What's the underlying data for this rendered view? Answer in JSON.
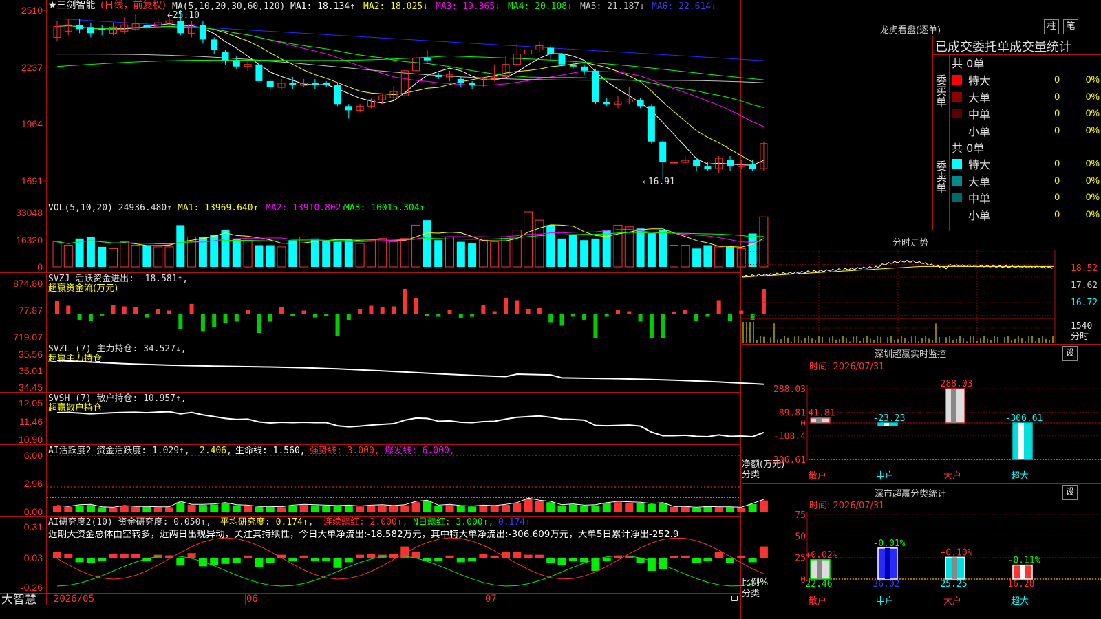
{
  "colors": {
    "up": "#ff3232",
    "down": "#00ffff",
    "grid": "#b01010",
    "ma1": "#ffffff",
    "ma2": "#ffff00",
    "ma3": "#ff00ff",
    "ma4": "#00ff00",
    "ma5": "#c0c0c0",
    "ma6": "#2828ff"
  },
  "header": {
    "stock_name": "★三剑智能",
    "period": "(日线，前复权)",
    "ma_params": "MA(5,10,20,30,60,120)",
    "ma1": "MA1: 18.134↑",
    "ma2": "MA2: 18.025↓",
    "ma3": "MA3: 19.365↓",
    "ma4": "MA4: 20.108↓",
    "ma5": "MA5: 21.187↓",
    "ma6": "MA6: 22.614↓",
    "high_mark": "←25.10",
    "low_mark": "←16.91"
  },
  "price_axis": [
    "2510",
    "2237",
    "1964",
    "1691"
  ],
  "vol_panel": {
    "title": "VOL(5,10,20) 24936.480↑",
    "ma1": "MA1: 13969.640↑",
    "ma2": "MA2: 13910.802↑",
    "ma3": "MA3: 16015.304↑",
    "axis": [
      "33048",
      "16320",
      "0"
    ]
  },
  "svzj_panel": {
    "title": "SVZJ  活跃资金进出: -18.581↑,",
    "subtitle": "超赢资金流(万元)",
    "axis": [
      "874.80",
      "77.87",
      "-719.07"
    ]
  },
  "svzl_panel": {
    "title": "SVZL (7) 主力持仓: 34.527↓,",
    "subtitle": "超赢主力持仓",
    "axis": [
      "35.56",
      "35.01",
      "34.45"
    ]
  },
  "svsh_panel": {
    "title": "SVSH (7) 散户持仓: 10.957↑,",
    "subtitle": "超赢散户持仓",
    "axis": [
      "12.05",
      "11.46",
      "10.90"
    ]
  },
  "ai1_panel": {
    "title": "AI活跃度2 资金活跃度: 1.029↑,",
    "v2": "2.406,",
    "life": "生命线: 1.560,",
    "strong": "强势线: 3.000,",
    "burst": "爆发线: 6.000,",
    "axis": [
      "6.00",
      "2.96",
      "0.00"
    ]
  },
  "ai2_panel": {
    "title": "AI研究度2(10) 资金研究度: 0.050↑,",
    "avg": "平均研究度: 0.174↑,",
    "cont": "连续飘红: 2.000↑,",
    "nday": "N日飘红: 3.000↑,",
    "last": "0.174↑",
    "commentary": "近期大资金总体由空转多，近两日出现异动，关注其持续性，今日大单净流出:-18.582万元，其中特大单净流出:-306.609万元，大单5日累计净出-252.9",
    "axis": [
      "0.31",
      "0.03",
      "-0.26"
    ]
  },
  "date_axis": [
    "2026/05",
    "06",
    "07"
  ],
  "logo": "大智慧",
  "right": {
    "dragon_title": "龙虎看盘(逐单)",
    "btn1": "柱",
    "btn2": "笔",
    "table_head": "已成交委托单成交量统计",
    "buy_label": "委买单",
    "sell_label": "委卖单",
    "buy_total": "共 0单",
    "sell_total": "共 0单",
    "buy_rows": [
      {
        "name": "特大",
        "val": "0",
        "pct": "0%",
        "color": "#ff0000"
      },
      {
        "name": "大单",
        "val": "0",
        "pct": "0%",
        "color": "#8b0000"
      },
      {
        "name": "中单",
        "val": "0",
        "pct": "0%",
        "color": "#5a0000"
      },
      {
        "name": "小单",
        "val": "0",
        "pct": "0%",
        "color": ""
      }
    ],
    "sell_rows": [
      {
        "name": "特大",
        "val": "0",
        "pct": "0%",
        "color": "#00ffff"
      },
      {
        "name": "大单",
        "val": "0",
        "pct": "0%",
        "color": "#008b8b"
      },
      {
        "name": "中单",
        "val": "0",
        "pct": "0%",
        "color": "#006b6b"
      },
      {
        "name": "小单",
        "val": "0",
        "pct": "0%",
        "color": ""
      }
    ],
    "intraday_title": "分时走势",
    "intraday_axis": [
      "18.52",
      "17.62",
      "16.72"
    ],
    "intraday_vol": "1540",
    "intraday_label": "分时",
    "sz_title": "深圳超赢实时监控",
    "sz_time": "时间: 2026/07/31",
    "sz_btn": "设",
    "sz_axis": [
      "288.03",
      "89.81",
      "0",
      "-108.4",
      "-306.61"
    ],
    "sz_bars": [
      {
        "cat": "散户",
        "value": 41.81,
        "label": "41.81"
      },
      {
        "cat": "中户",
        "value": -23.23,
        "label": "-23.23"
      },
      {
        "cat": "大户",
        "value": 288.03,
        "label": "288.03"
      },
      {
        "cat": "超大",
        "value": -306.61,
        "label": "-306.61"
      }
    ],
    "sz_ylabel": "净额(万元)",
    "sz_xlabel": "分类",
    "sc_title": "深市超赢分类统计",
    "sc_time": "时间: 2026/07/31",
    "sc_btn": "设",
    "sc_axis": [
      "75",
      "50",
      "25",
      "0"
    ],
    "sc_bars": [
      {
        "cat": "散户",
        "value": 22.46,
        "label": "22.46",
        "chg": "+0.02%"
      },
      {
        "cat": "中户",
        "value": 36.02,
        "label": "36.02",
        "chg": "-0.01%"
      },
      {
        "cat": "大户",
        "value": 25.25,
        "label": "25.25",
        "chg": "+0.10%"
      },
      {
        "cat": "超大",
        "value": 16.28,
        "label": "16.28",
        "chg": "-0.11%"
      }
    ],
    "sc_ylabel": "比例%",
    "sc_xlabel": "分类"
  },
  "chart_data": {
    "type": "candlestick",
    "candles": [
      [
        2380,
        2432,
        2460,
        2360
      ],
      [
        2410,
        2440,
        2470,
        2390
      ],
      [
        2440,
        2420,
        2470,
        2400
      ],
      [
        2430,
        2400,
        2450,
        2380
      ],
      [
        2420,
        2415,
        2440,
        2390
      ],
      [
        2400,
        2430,
        2450,
        2390
      ],
      [
        2410,
        2440,
        2480,
        2395
      ],
      [
        2420,
        2445,
        2490,
        2410
      ],
      [
        2440,
        2430,
        2460,
        2410
      ],
      [
        2430,
        2450,
        2480,
        2420
      ],
      [
        2450,
        2460,
        2500,
        2430
      ],
      [
        2460,
        2400,
        2510,
        2390
      ],
      [
        2400,
        2440,
        2460,
        2380
      ],
      [
        2440,
        2370,
        2460,
        2350
      ],
      [
        2370,
        2320,
        2380,
        2300
      ],
      [
        2310,
        2270,
        2320,
        2250
      ],
      [
        2270,
        2240,
        2290,
        2230
      ],
      [
        2240,
        2250,
        2280,
        2220
      ],
      [
        2250,
        2170,
        2260,
        2160
      ],
      [
        2170,
        2140,
        2180,
        2120
      ],
      [
        2140,
        2160,
        2180,
        2130
      ],
      [
        2160,
        2150,
        2190,
        2130
      ],
      [
        2150,
        2160,
        2180,
        2140
      ],
      [
        2160,
        2150,
        2180,
        2130
      ],
      [
        2160,
        2150,
        2170,
        2140
      ],
      [
        2150,
        2060,
        2160,
        2050
      ],
      [
        2050,
        2030,
        2060,
        1990
      ],
      [
        2030,
        2050,
        2060,
        2020
      ],
      [
        2050,
        2080,
        2090,
        2040
      ],
      [
        2080,
        2100,
        2110,
        2060
      ],
      [
        2090,
        2120,
        2140,
        2080
      ],
      [
        2100,
        2220,
        2230,
        2090
      ],
      [
        2220,
        2280,
        2300,
        2200
      ],
      [
        2280,
        2270,
        2320,
        2260
      ],
      [
        2200,
        2190,
        2210,
        2180
      ],
      [
        2190,
        2200,
        2220,
        2170
      ],
      [
        2180,
        2160,
        2190,
        2140
      ],
      [
        2160,
        2150,
        2170,
        2130
      ],
      [
        2150,
        2180,
        2190,
        2140
      ],
      [
        2180,
        2190,
        2250,
        2170
      ],
      [
        2190,
        2250,
        2290,
        2180
      ],
      [
        2250,
        2300,
        2350,
        2240
      ],
      [
        2300,
        2320,
        2340,
        2290
      ],
      [
        2320,
        2340,
        2360,
        2310
      ],
      [
        2330,
        2300,
        2340,
        2270
      ],
      [
        2300,
        2250,
        2310,
        2240
      ],
      [
        2250,
        2240,
        2260,
        2230
      ],
      [
        2240,
        2220,
        2250,
        2200
      ],
      [
        2220,
        2070,
        2230,
        2060
      ],
      [
        2070,
        2060,
        2090,
        2050
      ],
      [
        2060,
        2070,
        2100,
        2040
      ],
      [
        2070,
        2080,
        2140,
        2060
      ],
      [
        2080,
        2050,
        2090,
        2040
      ],
      [
        2050,
        1880,
        2060,
        1870
      ],
      [
        1880,
        1780,
        1890,
        1700
      ],
      [
        1780,
        1780,
        1800,
        1760
      ],
      [
        1780,
        1790,
        1810,
        1770
      ],
      [
        1790,
        1760,
        1800,
        1740
      ],
      [
        1760,
        1750,
        1780,
        1740
      ],
      [
        1750,
        1800,
        1810,
        1730
      ],
      [
        1790,
        1760,
        1810,
        1740
      ],
      [
        1760,
        1770,
        1790,
        1750
      ],
      [
        1770,
        1750,
        1790,
        1740
      ],
      [
        1750,
        1870,
        1880,
        1740
      ]
    ],
    "volume": [
      15,
      13,
      17,
      18,
      12,
      11,
      15,
      13,
      13,
      12,
      12,
      25,
      18,
      18,
      19,
      22,
      17,
      16,
      13,
      13,
      12,
      16,
      18,
      17,
      16,
      15,
      16,
      14,
      16,
      17,
      15,
      17,
      25,
      28,
      16,
      18,
      15,
      14,
      16,
      15,
      18,
      22,
      33,
      28,
      25,
      17,
      19,
      16,
      17,
      22,
      25,
      24,
      23,
      20,
      22,
      13,
      13,
      11,
      13,
      12,
      12,
      11,
      20,
      30
    ],
    "ma_close": {
      "ma1": 18.134,
      "ma2": 18.025,
      "ma3": 19.365,
      "ma4": 20.108,
      "ma5": 21.187,
      "ma6": 22.614
    }
  }
}
